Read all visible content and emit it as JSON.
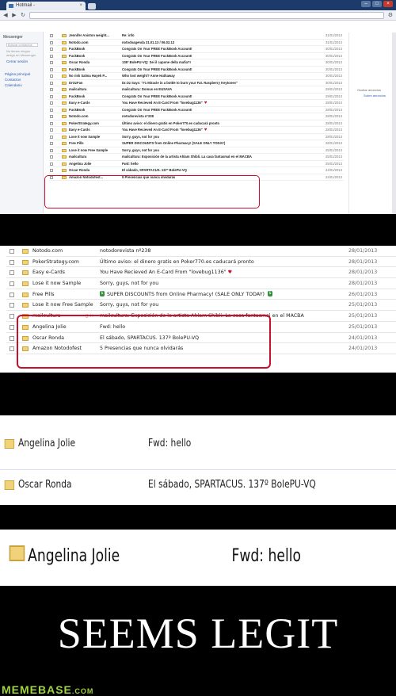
{
  "browser": {
    "tab_title": "Hotmail -"
  },
  "sidebar": {
    "header": "Messenger",
    "search_placeholder": "Buscar contactos",
    "empty_note": "No tienes ningún amigo en Messenger",
    "logout": "Cerrar sesión",
    "nav": [
      "Página principal",
      "Contactos",
      "Calendario"
    ]
  },
  "right_panel": {
    "ad_label": "Ocultar anuncios",
    "ad_link": "Sobre anuncios"
  },
  "inbox_full": [
    {
      "from": "Jennifer Aniston weight...",
      "subject": "Re: info",
      "date": "31/01/2013"
    },
    {
      "from": "Notodo.com",
      "subject": "notodoagenda 31.01.13 / 06.02.13",
      "date": "31/01/2013"
    },
    {
      "from": "FuckBook",
      "subject": "Congrats On Your FREE FuckBook Account!",
      "date": "30/01/2013"
    },
    {
      "from": "FuckBook",
      "subject": "Congrats On Your FREE FuckBook Account!",
      "date": "30/01/2013"
    },
    {
      "from": "Oscar Ronda",
      "subject": "138º BolePU-VQ: Sei il capone della mafia?!",
      "date": "30/01/2013"
    },
    {
      "from": "FuckBook",
      "subject": "Congrats On Your FREE FuckBook Account!",
      "date": "30/01/2013"
    },
    {
      "from": "No risk Salma Hayek P...",
      "subject": "Who lost weight? Anne Hathaway",
      "date": "30/01/2013"
    },
    {
      "from": "DrOzFan",
      "subject": "Dr.Oz Says: \"#1 Miracle in a bottle to burn your Fat. Raspberry Keytones\"",
      "date": "30/01/2013"
    },
    {
      "from": "mailcultura",
      "subject": "mailcultura: Domus en EUSAVA",
      "date": "29/01/2013"
    },
    {
      "from": "FuckBook",
      "subject": "Congrats On Your FREE FuckBook Account!",
      "date": "29/01/2013"
    },
    {
      "from": "Easy e-Cards",
      "subject": "You Have Recieved An E-Card From \"lovebug1136\"",
      "date": "28/01/2013"
    },
    {
      "from": "FuckBook",
      "subject": "Congrats On Your FREE FuckBook Account!",
      "date": "28/01/2013"
    },
    {
      "from": "Notodo.com",
      "subject": "notodorevista nº238",
      "date": "28/01/2013"
    },
    {
      "from": "PokerStrategy.com",
      "subject": "Último aviso: el dinero gratis en Poker770.es caducará pronto",
      "date": "28/01/2013"
    },
    {
      "from": "Easy e-Cards",
      "subject": "You Have Recieved An E-Card From \"lovebug1136\"",
      "date": "28/01/2013"
    },
    {
      "from": "Lose it now Sample",
      "subject": "Sorry, guys, not for you",
      "date": "28/01/2013"
    },
    {
      "from": "Free Pills",
      "subject": "SUPER DISCOUNTS from Online Pharmacy! (SALE ONLY TODAY)",
      "date": "26/01/2013"
    },
    {
      "from": "Lose it now Free Sample",
      "subject": "Sorry, guys, not for you",
      "date": "25/01/2013"
    },
    {
      "from": "mailcultura",
      "subject": "mailcultura: Exposición de la artista Ahlam Shibli. La casa fantasmal en el MACBA",
      "date": "25/01/2013"
    },
    {
      "from": "Angelina Jolie",
      "subject": "Fwd: hello",
      "date": "25/01/2013"
    },
    {
      "from": "Oscar Ronda",
      "subject": "El sábado, SPARTACUS. 137º BolePU-VQ",
      "date": "24/01/2013"
    },
    {
      "from": "Amazon Notodofest...",
      "subject": "5 Presencias que nunca olvidarás",
      "date": "24/01/2013"
    }
  ],
  "inbox_zoom": [
    {
      "from": "Notodo.com",
      "subject": "notodorevista nº238",
      "date": "28/01/2013"
    },
    {
      "from": "PokerStrategy.com",
      "subject": "Último aviso: el dinero gratis en Poker770.es caducará pronto",
      "date": "28/01/2013"
    },
    {
      "from": "Easy e-Cards",
      "subject": "You Have Recieved An E-Card From \"lovebug1136\"",
      "date": "28/01/2013"
    },
    {
      "from": "Lose it now Sample",
      "subject": "Sorry, guys, not for you",
      "date": "28/01/2013"
    },
    {
      "from": "Free Pills",
      "subject": "SUPER DISCOUNTS from Online Pharmacy! (SALE ONLY TODAY)",
      "date": "26/01/2013"
    },
    {
      "from": "Lose it now Free Sample",
      "subject": "Sorry, guys, not for you",
      "date": "25/01/2013"
    },
    {
      "from": "mailcultura",
      "subject": "mailcultura: Exposición de la artista Ahlam Shibli. La casa fantasmal en el MACBA",
      "date": "25/01/2013"
    },
    {
      "from": "Angelina Jolie",
      "subject": "Fwd: hello",
      "date": "25/01/2013"
    },
    {
      "from": "Oscar Ronda",
      "subject": "El sábado, SPARTACUS. 137º BolePU-VQ",
      "date": "24/01/2013"
    },
    {
      "from": "Amazon Notodofest",
      "subject": "5 Presencias que nunca olvidarás",
      "date": "24/01/2013"
    }
  ],
  "zoom2": [
    {
      "from": "Angelina Jolie",
      "subject": "Fwd: hello"
    },
    {
      "from": "Oscar Ronda",
      "subject": "El sábado, SPARTACUS. 137º BolePU-VQ"
    }
  ],
  "zoom3": {
    "from": "Angelina Jolie",
    "subject": "Fwd: hello"
  },
  "caption": "SEEMS LEGIT",
  "brand": {
    "name": "MEMEBASE",
    "domain": ".COM"
  },
  "colors": {
    "highlight": "#c8102e",
    "brand": "#9fd43a",
    "envelope": "#f1d27a"
  }
}
